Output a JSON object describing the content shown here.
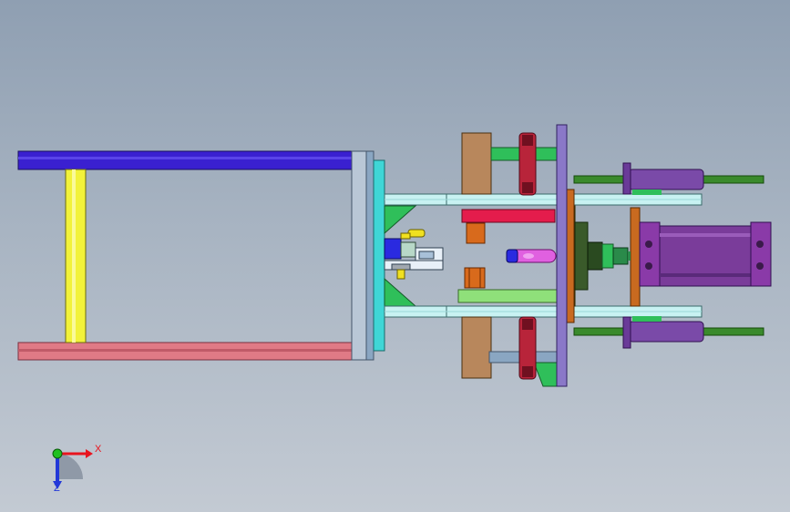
{
  "viewport": {
    "background": [
      "#8f9fb2",
      "#c3cad3"
    ]
  },
  "triad": {
    "x_label": "X",
    "z_label": "Z",
    "x_color": "#e8141e",
    "y_color": "#20c020",
    "z_color": "#2238d8"
  },
  "palette": {
    "frame_top_bar": "#3a20d0",
    "frame_bottom_bar": "#e07a86",
    "frame_post": "#f2f23a",
    "mount_plate": "#8aa6c2",
    "cyan_plate": "#3fd6d6",
    "wood_block": "#b8875c",
    "slide_rail": "#c8f2f2",
    "red_block": "#e41c4c",
    "green_plate": "#2fbf5a",
    "lime_plate": "#8fe07a",
    "rod_red": "#b8243a",
    "purple_plate": "#8a78c8",
    "cylinder_body": "#7a3c9a",
    "guide_rod": "#3a8a2c",
    "orange_plate": "#c86a20",
    "olive_plate": "#6a6a20",
    "copper": "#d86a1c",
    "magenta_pin": "#e060e0"
  }
}
